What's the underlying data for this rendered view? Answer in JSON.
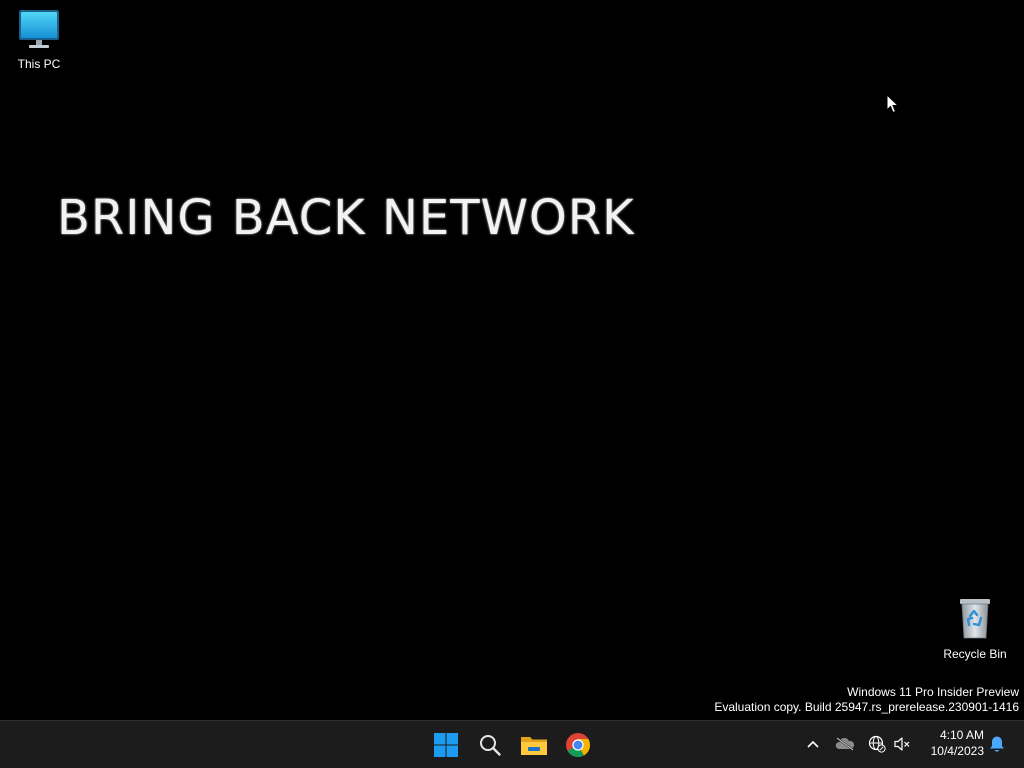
{
  "desktop": {
    "background_color": "#000000",
    "icons": [
      {
        "name": "This PC",
        "icon": "computer-icon"
      },
      {
        "name": "Recycle Bin",
        "icon": "recycle-bin-icon"
      }
    ],
    "wallpaper_text": "BRING BACK NETWORK",
    "watermark": {
      "line1": "Windows 11 Pro Insider Preview",
      "line2": "Evaluation copy. Build 25947.rs_prerelease.230901-1416"
    }
  },
  "taskbar": {
    "background_color": "#1c1c1c",
    "pinned": [
      {
        "name": "Start",
        "icon": "windows-start-icon"
      },
      {
        "name": "Search",
        "icon": "search-icon"
      },
      {
        "name": "File Explorer",
        "icon": "folder-icon"
      },
      {
        "name": "Google Chrome",
        "icon": "chrome-icon"
      }
    ],
    "tray": {
      "icons": [
        "chevron-up-icon",
        "onedrive-icon",
        "network-disconnected-icon",
        "volume-muted-icon",
        "notification-bell-icon"
      ],
      "time": "4:10 AM",
      "date": "10/4/2023"
    }
  }
}
